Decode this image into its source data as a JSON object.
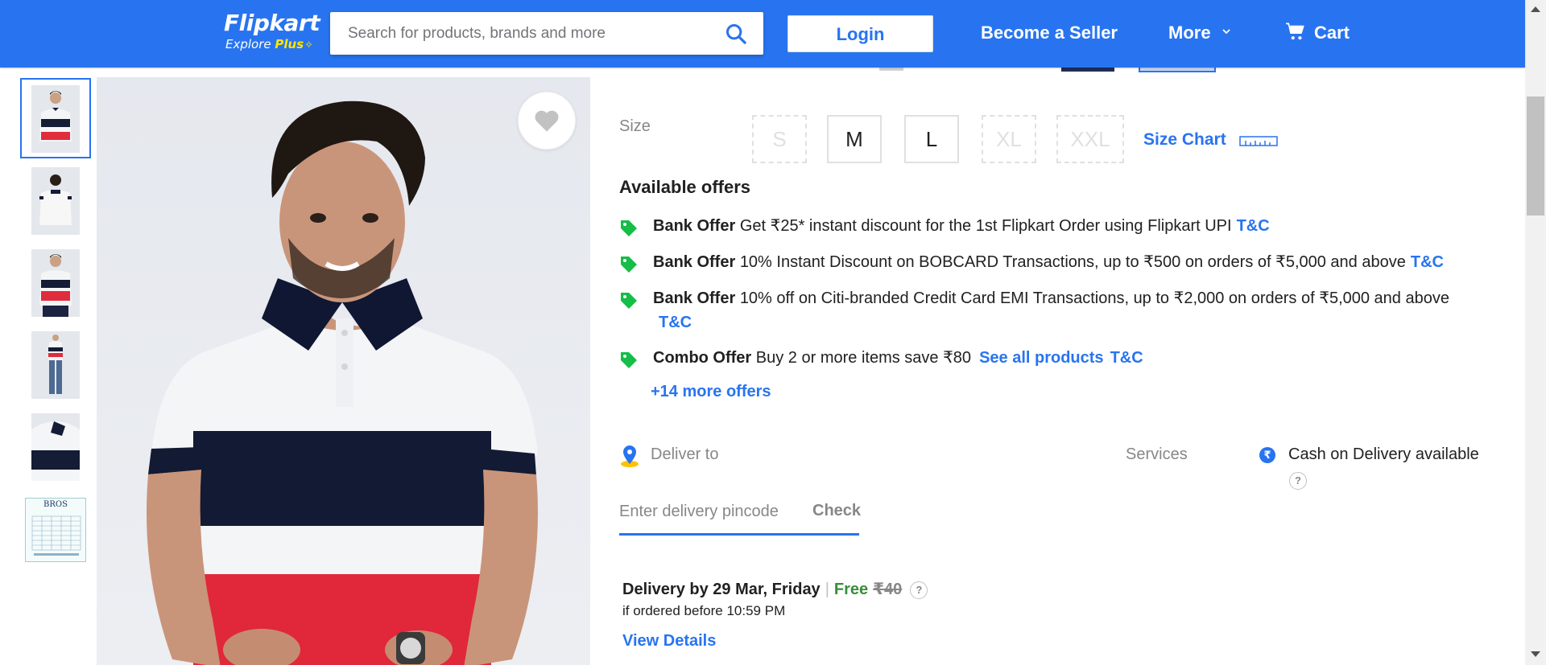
{
  "header": {
    "logo_text": "Flipkart",
    "logo_sub_text": "Explore",
    "logo_plus_text": "Plus",
    "search_placeholder": "Search for products, brands and more",
    "login_label": "Login",
    "seller_label": "Become a Seller",
    "more_label": "More",
    "cart_label": "Cart",
    "brand_color": "#2874f0"
  },
  "gallery": {
    "thumbnails": [
      {
        "name": "thumb-front",
        "active": true
      },
      {
        "name": "thumb-back",
        "active": false
      },
      {
        "name": "thumb-front-2",
        "active": false
      },
      {
        "name": "thumb-full",
        "active": false
      },
      {
        "name": "thumb-collar",
        "active": false
      },
      {
        "name": "thumb-size-chart",
        "active": false,
        "label": "BROS"
      }
    ]
  },
  "size": {
    "label": "Size",
    "options": [
      {
        "label": "S",
        "available": false
      },
      {
        "label": "M",
        "available": true
      },
      {
        "label": "L",
        "available": true
      },
      {
        "label": "XL",
        "available": false
      },
      {
        "label": "XXL",
        "available": false
      }
    ],
    "chart_label": "Size Chart"
  },
  "offers": {
    "title": "Available offers",
    "items": [
      {
        "type": "Bank Offer",
        "text": "Get ₹25* instant discount for the 1st Flipkart Order using Flipkart UPI",
        "tc": "T&C"
      },
      {
        "type": "Bank Offer",
        "text": "10% Instant Discount on BOBCARD Transactions, up to ₹500 on orders of ₹5,000 and above",
        "tc": "T&C"
      },
      {
        "type": "Bank Offer",
        "text": "10% off on Citi-branded Credit Card EMI Transactions, up to ₹2,000 on orders of ₹5,000 and above",
        "tc": "T&C"
      },
      {
        "type": "Combo Offer",
        "text": "Buy 2 or more items save ₹80",
        "link": "See all products",
        "tc": "T&C"
      }
    ],
    "more_label": "+14 more offers"
  },
  "delivery": {
    "deliver_to_label": "Deliver to",
    "pincode_placeholder": "Enter delivery pincode",
    "check_label": "Check",
    "services_label": "Services",
    "cod_symbol": "₹",
    "cod_text": "Cash on Delivery available",
    "help_symbol": "?",
    "delivery_by": "Delivery by 29 Mar, Friday",
    "separator": "|",
    "free_label": "Free",
    "original_fee": "₹40",
    "cutoff_text": "if ordered before 10:59 PM",
    "view_details_label": "View Details"
  }
}
